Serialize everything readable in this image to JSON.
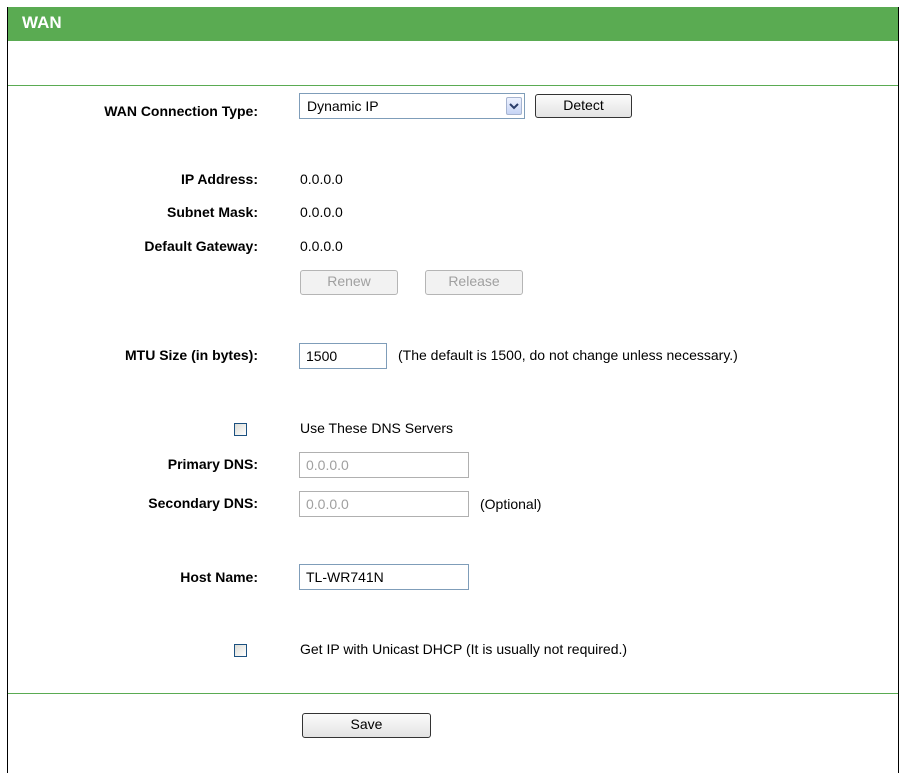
{
  "header": {
    "title": "WAN"
  },
  "form": {
    "connection_type": {
      "label": "WAN Connection Type:",
      "value": "Dynamic IP",
      "detect_label": "Detect"
    },
    "ip_address": {
      "label": "IP Address:",
      "value": "0.0.0.0"
    },
    "subnet_mask": {
      "label": "Subnet Mask:",
      "value": "0.0.0.0"
    },
    "default_gateway": {
      "label": "Default Gateway:",
      "value": "0.0.0.0"
    },
    "renew_label": "Renew",
    "release_label": "Release",
    "mtu": {
      "label": "MTU Size (in bytes):",
      "value": "1500",
      "note": "(The default is 1500, do not change unless necessary.)"
    },
    "dns": {
      "checkbox_label": "Use These DNS Servers",
      "primary_label": "Primary DNS:",
      "primary_value": "0.0.0.0",
      "secondary_label": "Secondary DNS:",
      "secondary_value": "0.0.0.0",
      "optional_note": "(Optional)"
    },
    "host_name": {
      "label": "Host Name:",
      "value": "TL-WR741N"
    },
    "unicast": {
      "checkbox_label": "Get IP with Unicast DHCP (It is usually not required.)"
    },
    "save_label": "Save"
  },
  "colors": {
    "header": "#5aab52",
    "divider": "#5aab52",
    "input_border": "#7f9db9"
  }
}
